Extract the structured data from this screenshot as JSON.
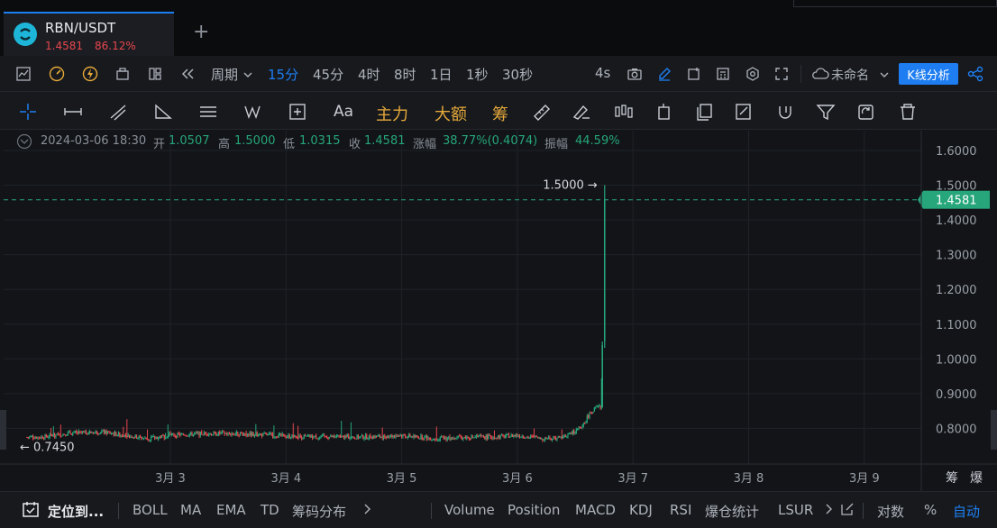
{
  "tab": {
    "symbol": "RBN/USDT",
    "price": "1.4581",
    "change_pct": "86.12%",
    "add": "+"
  },
  "toolbar1": {
    "period_label": "周期",
    "intervals": [
      "15分",
      "45分",
      "4时",
      "8时",
      "1日",
      "1秒",
      "30秒"
    ],
    "active_interval": "15分",
    "right_interval": "4s",
    "layout_name": "未命名",
    "analysis_button": "K线分析"
  },
  "toolbar2": {
    "text_tool": "Aa",
    "zhuli": "主力",
    "dae": "大额",
    "chou": "筹"
  },
  "ohlc": {
    "datetime": "2024-03-06 18:30",
    "open_label": "开",
    "open": "1.0507",
    "high_label": "高",
    "high": "1.5000",
    "low_label": "低",
    "low": "1.0315",
    "close_label": "收",
    "close": "1.4581",
    "change_label": "涨幅",
    "change": "38.77%(0.4074)",
    "amp_label": "振幅",
    "amp": "44.59%"
  },
  "chart": {
    "high_marker": "1.5000",
    "low_marker": "0.7450",
    "last_price": "1.4581",
    "side_chou": "筹",
    "side_bao": "爆"
  },
  "chart_data": {
    "type": "candlestick",
    "symbol": "RBN/USDT",
    "y_ticks": [
      "1.6000",
      "1.5000",
      "1.4000",
      "1.3000",
      "1.2000",
      "1.1000",
      "1.0000",
      "0.9000",
      "0.8000"
    ],
    "ylim": [
      0.7,
      1.62
    ],
    "x_ticks": [
      "3月 3",
      "3月 4",
      "3月 5",
      "3月 6",
      "3月 7",
      "3月 8",
      "3月 9"
    ],
    "x_tick_days": [
      3,
      4,
      5,
      6,
      7,
      8,
      9
    ],
    "xlim_days": [
      1.74,
      9.5
    ],
    "last_price": 1.4581,
    "high": 1.5,
    "low": 0.745,
    "price_path": [
      [
        1.76,
        0.775
      ],
      [
        1.9,
        0.775
      ],
      [
        2.1,
        0.785
      ],
      [
        2.4,
        0.79
      ],
      [
        2.6,
        0.78
      ],
      [
        2.8,
        0.77
      ],
      [
        3.0,
        0.78
      ],
      [
        3.3,
        0.785
      ],
      [
        3.6,
        0.785
      ],
      [
        3.9,
        0.78
      ],
      [
        4.1,
        0.775
      ],
      [
        4.4,
        0.775
      ],
      [
        4.7,
        0.775
      ],
      [
        5.0,
        0.78
      ],
      [
        5.3,
        0.77
      ],
      [
        5.6,
        0.775
      ],
      [
        5.8,
        0.775
      ],
      [
        6.0,
        0.78
      ],
      [
        6.2,
        0.77
      ],
      [
        6.4,
        0.775
      ],
      [
        6.55,
        0.8
      ],
      [
        6.62,
        0.84
      ],
      [
        6.68,
        0.86
      ],
      [
        6.72,
        0.86
      ],
      [
        6.74,
        1.04
      ],
      [
        6.76,
        1.4581
      ]
    ]
  },
  "bottombar": {
    "locate": "定位到...",
    "left_indicators": [
      "BOLL",
      "MA",
      "EMA",
      "TD",
      "筹码分布"
    ],
    "right_indicators": [
      "Volume",
      "Position",
      "MACD",
      "KDJ",
      "RSI",
      "爆仓统计",
      "LSUR"
    ],
    "log_label": "对数",
    "pct_label": "%",
    "auto_label": "自动"
  },
  "colors": {
    "up": "#26a67a",
    "down": "#e8474d",
    "accent": "#1e7ef1",
    "gold": "#e6a93a"
  }
}
